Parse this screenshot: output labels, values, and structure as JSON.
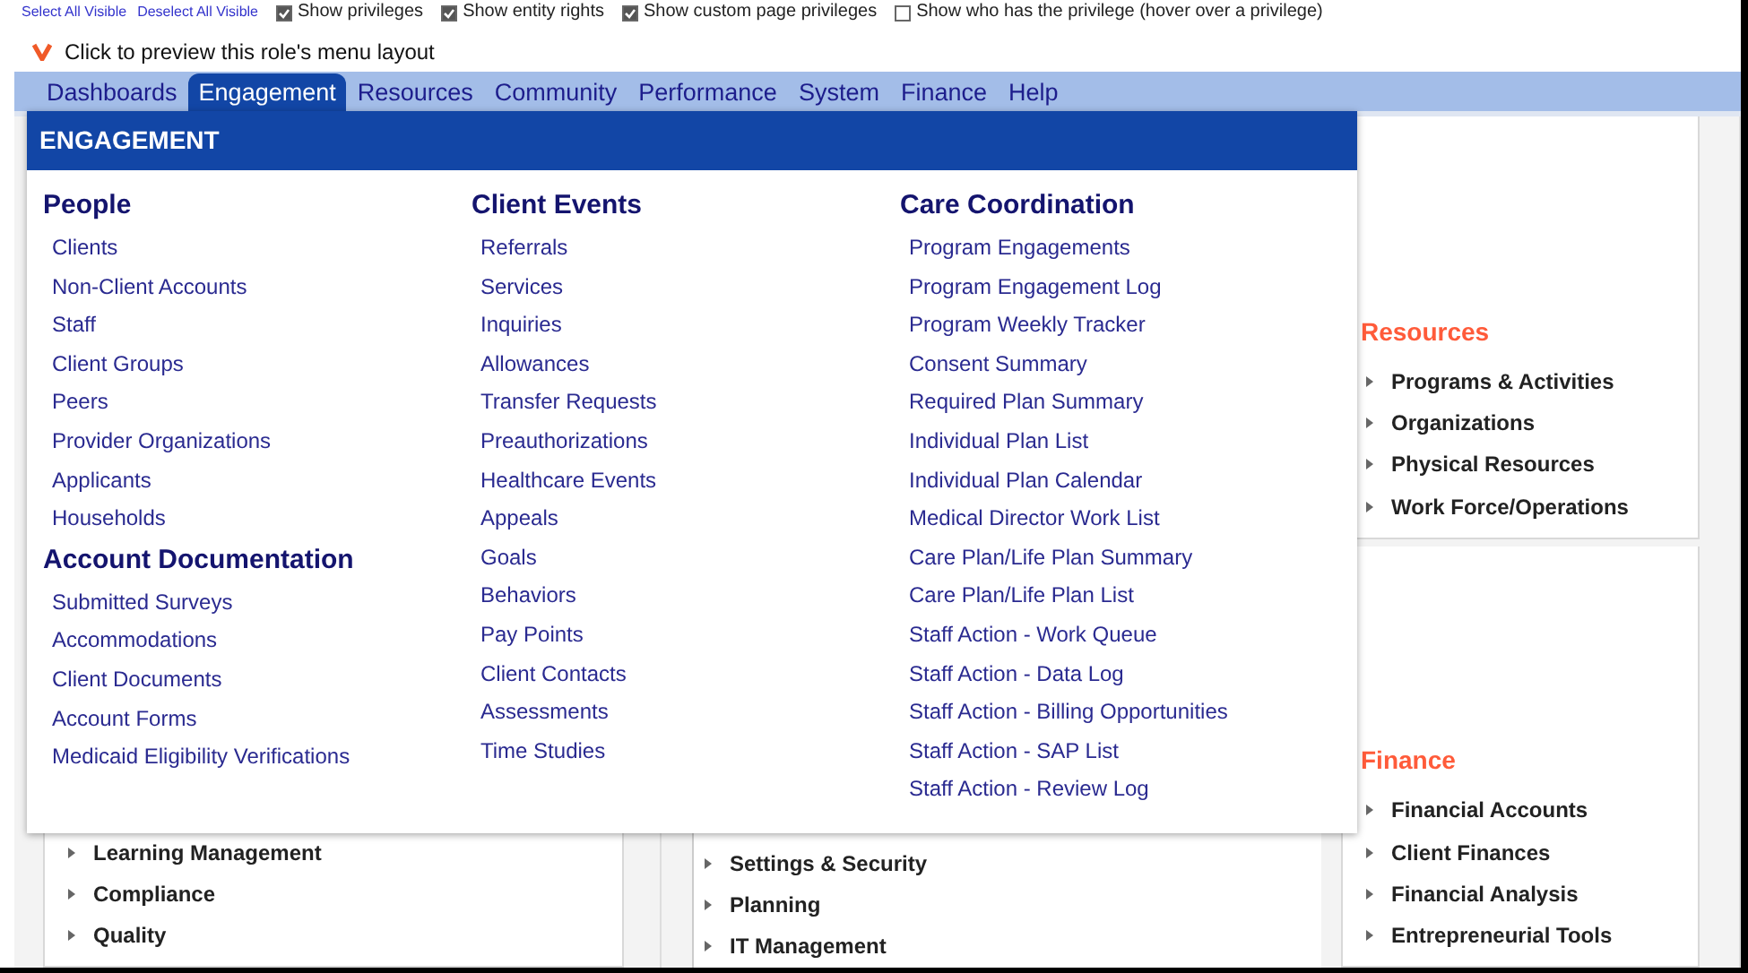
{
  "toolbar": {
    "links": [
      "Select All Visible",
      "Deselect All Visible"
    ],
    "options": [
      {
        "label": "Show privileges",
        "checked": true
      },
      {
        "label": "Show entity rights",
        "checked": true
      },
      {
        "label": "Show custom page privileges",
        "checked": true
      },
      {
        "label": "Show who has the privilege (hover over a privilege)",
        "checked": false
      }
    ]
  },
  "preview": {
    "label": "Click to preview this role's menu layout"
  },
  "tabs": [
    {
      "label": "Dashboards",
      "selected": false
    },
    {
      "label": "Engagement",
      "selected": true
    },
    {
      "label": "Resources",
      "selected": false
    },
    {
      "label": "Community",
      "selected": false
    },
    {
      "label": "Performance",
      "selected": false
    },
    {
      "label": "System",
      "selected": false
    },
    {
      "label": "Finance",
      "selected": false
    },
    {
      "label": "Help",
      "selected": false
    }
  ],
  "dropdown": {
    "title": "ENGAGEMENT",
    "columns": [
      {
        "sections": [
          {
            "heading": "People",
            "items": [
              "Clients",
              "Non-Client Accounts",
              "Staff",
              "Client Groups",
              "Peers",
              "Provider Organizations",
              "Applicants",
              "Households"
            ]
          },
          {
            "heading": "Account Documentation",
            "items": [
              "Submitted Surveys",
              "Accommodations",
              "Client Documents",
              "Account Forms",
              "Medicaid Eligibility Verifications"
            ]
          }
        ]
      },
      {
        "sections": [
          {
            "heading": "Client Events",
            "items": [
              "Referrals",
              "Services",
              "Inquiries",
              "Allowances",
              "Transfer Requests",
              "Preauthorizations",
              "Healthcare Events",
              "Appeals",
              "Goals",
              "Behaviors",
              "Pay Points",
              "Client Contacts",
              "Assessments",
              "Time Studies"
            ]
          }
        ]
      },
      {
        "sections": [
          {
            "heading": "Care Coordination",
            "items": [
              "Program Engagements",
              "Program Engagement Log",
              "Program Weekly Tracker",
              "Consent Summary",
              "Required Plan Summary",
              "Individual Plan List",
              "Individual Plan Calendar",
              "Medical Director Work List",
              "Care Plan/Life Plan Summary",
              "Care Plan/Life Plan List",
              "Staff Action - Work Queue",
              "Staff Action - Data Log",
              "Staff Action - Billing Opportunities",
              "Staff Action - SAP List",
              "Staff Action - Review Log"
            ]
          }
        ]
      }
    ]
  },
  "background": {
    "columns": [
      {
        "cards": [
          {
            "items": [
              "Learning Management",
              "Compliance",
              "Quality"
            ]
          }
        ]
      },
      {
        "cards": [
          {
            "items": [
              "Settings & Security",
              "Planning",
              "IT Management"
            ]
          }
        ]
      },
      {
        "cards": [
          {
            "heading": "Resources",
            "items": [
              "Programs & Activities",
              "Organizations",
              "Physical Resources",
              "Work Force/Operations"
            ]
          },
          {
            "heading": "Finance",
            "items": [
              "Financial Accounts",
              "Client Finances",
              "Financial Analysis",
              "Entrepreneurial Tools"
            ]
          }
        ]
      }
    ]
  }
}
